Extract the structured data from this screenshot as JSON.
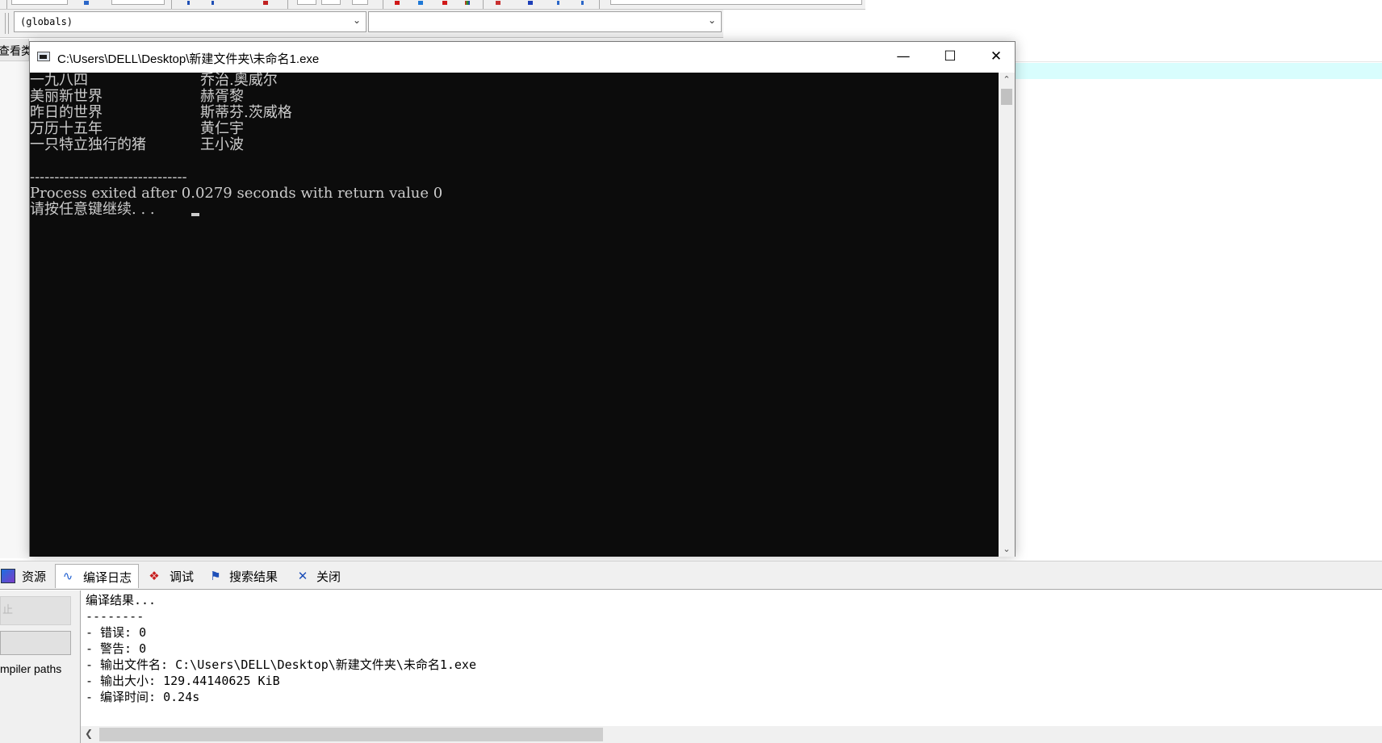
{
  "toolbar": {
    "scope_combo_value": "(globals)",
    "member_combo_value": ""
  },
  "left_panel": {
    "tab_label": "查看类",
    "button_top_label": "止",
    "compiler_paths_label": "mpiler paths"
  },
  "console_window": {
    "title": "C:\\Users\\DELL\\Desktop\\新建文件夹\\未命名1.exe",
    "minimize_glyph": "—",
    "maximize_glyph": "☐",
    "close_glyph": "✕",
    "rows": [
      {
        "book": "一九八四",
        "author": "乔治.奥威尔"
      },
      {
        "book": "美丽新世界",
        "author": "赫胥黎"
      },
      {
        "book": "昨日的世界",
        "author": "斯蒂芬.茨威格"
      },
      {
        "book": "万历十五年",
        "author": "黄仁宇"
      },
      {
        "book": "一只特立独行的猪",
        "author": "王小波"
      }
    ],
    "separator": "--------------------------------",
    "exit_message": "Process exited after 0.0279 seconds with return value 0",
    "continue_prompt": "请按任意键继续. . ."
  },
  "bottom_tabs": [
    {
      "label": "资源",
      "icon": "resources-icon"
    },
    {
      "label": "编译日志",
      "icon": "compile-log-icon"
    },
    {
      "label": "调试",
      "icon": "debug-icon"
    },
    {
      "label": "搜索结果",
      "icon": "search-results-icon"
    },
    {
      "label": "关闭",
      "icon": "close-x-icon"
    }
  ],
  "compile_log": {
    "lines": [
      "编译结果...",
      "--------",
      "- 错误: 0",
      "- 警告: 0",
      "- 输出文件名: C:\\Users\\DELL\\Desktop\\新建文件夹\\未命名1.exe",
      "- 输出大小: 129.44140625 KiB",
      "- 编译时间: 0.24s"
    ]
  },
  "colors": {
    "console_bg": "#0c0c0c",
    "console_text": "#cccccc",
    "editor_highlight": "#d8fdfd",
    "toolbar_bg": "#f0f0f0"
  }
}
